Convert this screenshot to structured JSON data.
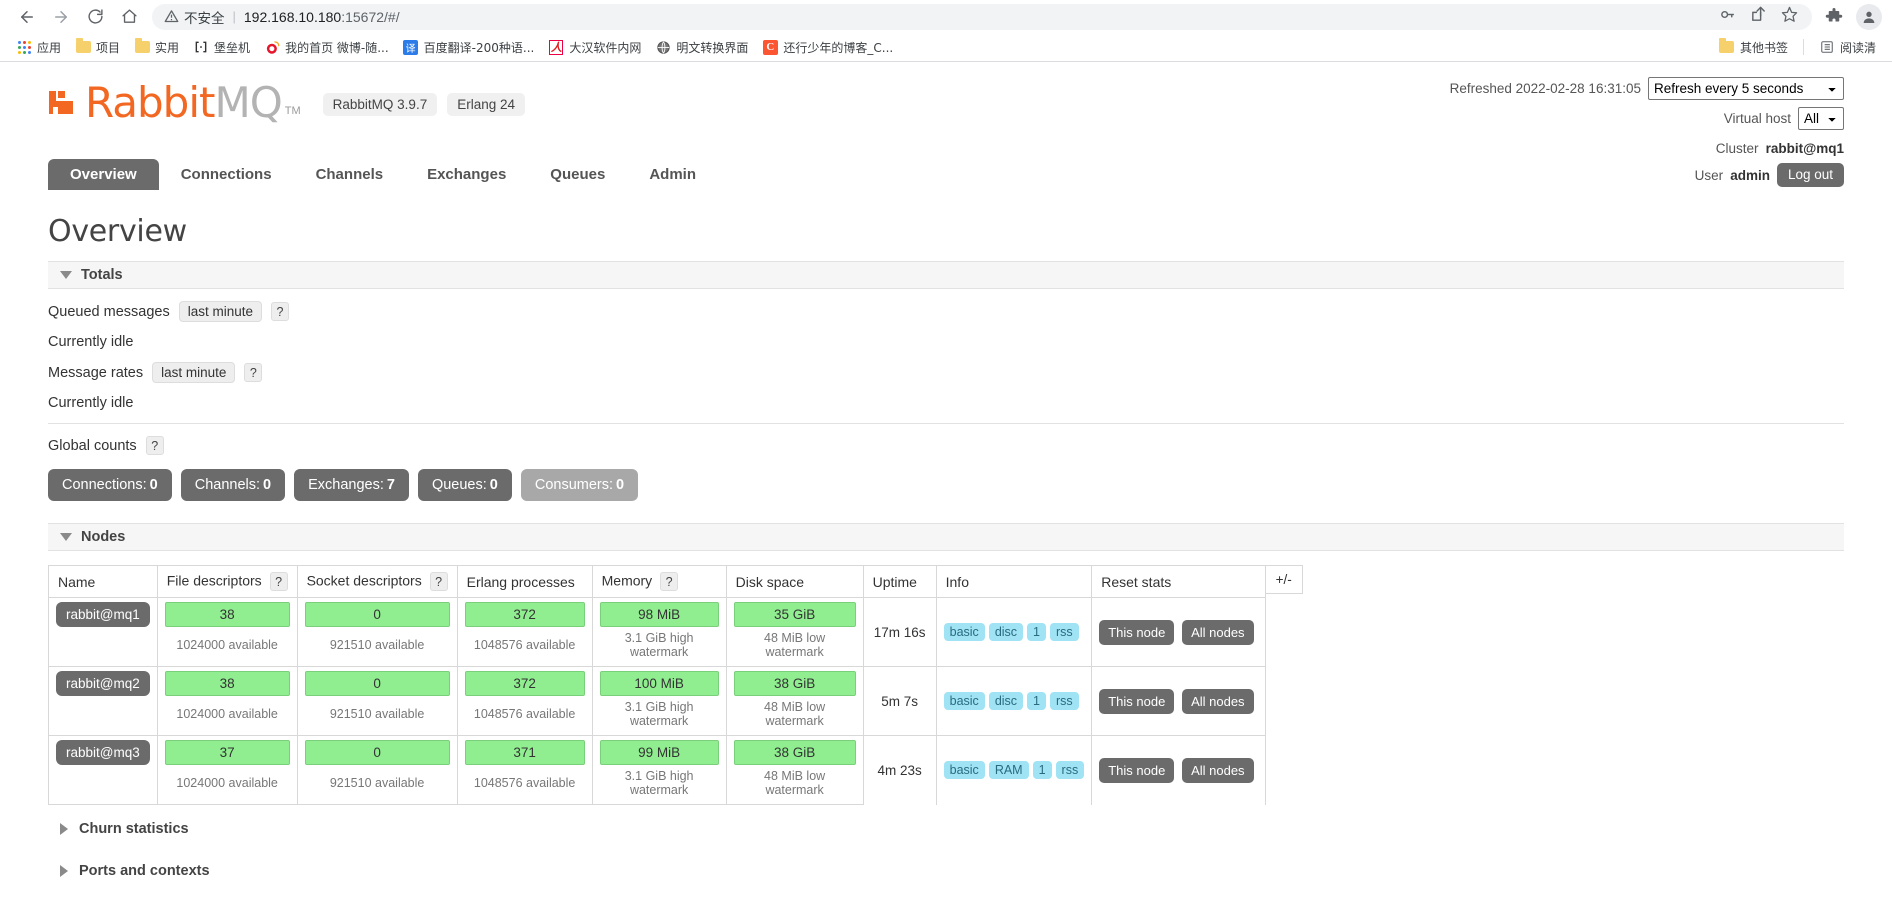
{
  "browser": {
    "nav": {
      "back_icon": "arrow-left-icon",
      "forward_icon": "arrow-right-icon",
      "reload_icon": "reload-icon",
      "home_icon": "home-icon"
    },
    "omnibox": {
      "security_label": "不安全",
      "separator": "|",
      "url_host": "192.168.10.180",
      "url_rest": ":15672/#/",
      "url_full": "192.168.10.180:15672/#/"
    },
    "toolbar_icons": [
      "key-icon",
      "share-icon",
      "star-icon",
      "extensions-icon",
      "profile-avatar-icon"
    ],
    "bookmarks": [
      {
        "label": "应用",
        "icon": "apps-grid-icon"
      },
      {
        "label": "项目",
        "icon": "folder-icon"
      },
      {
        "label": "实用",
        "icon": "folder-icon"
      },
      {
        "label": "堡垒机",
        "icon": "bracket-icon"
      },
      {
        "label": "我的首页 微博-随...",
        "icon": "weibo-icon"
      },
      {
        "label": "百度翻译-200种语...",
        "icon": "translate-icon"
      },
      {
        "label": "大汉软件内网",
        "icon": "pdf-icon"
      },
      {
        "label": "明文转换界面",
        "icon": "globe-icon"
      },
      {
        "label": "还行少年的博客_C...",
        "icon": "csdn-icon"
      }
    ],
    "bookmarks_right": [
      {
        "label": "其他书签",
        "icon": "folder-icon"
      },
      {
        "label": "阅读清",
        "icon": "reading-list-icon"
      }
    ]
  },
  "header": {
    "logo_rabbit": "Rabbit",
    "logo_mq": "MQ",
    "logo_tm": "TM",
    "badges": [
      "RabbitMQ 3.9.7",
      "Erlang 24"
    ],
    "refreshed_label": "Refreshed 2022-02-28 16:31:05",
    "refresh_select": "Refresh every 5 seconds",
    "vhost_label": "Virtual host",
    "vhost_select": "All",
    "cluster_label": "Cluster",
    "cluster_value": "rabbit@mq1",
    "user_label": "User",
    "user_value": "admin",
    "logout_label": "Log out"
  },
  "tabs": [
    {
      "label": "Overview",
      "active": true
    },
    {
      "label": "Connections",
      "active": false
    },
    {
      "label": "Channels",
      "active": false
    },
    {
      "label": "Exchanges",
      "active": false
    },
    {
      "label": "Queues",
      "active": false
    },
    {
      "label": "Admin",
      "active": false
    }
  ],
  "page": {
    "title": "Overview"
  },
  "totals": {
    "section_label": "Totals",
    "queued_label": "Queued messages",
    "queued_period": "last minute",
    "queued_idle": "Currently idle",
    "rates_label": "Message rates",
    "rates_period": "last minute",
    "rates_idle": "Currently idle",
    "global_counts_label": "Global counts",
    "help_glyph": "?",
    "counts": [
      {
        "label": "Connections:",
        "value": "0",
        "muted": false
      },
      {
        "label": "Channels:",
        "value": "0",
        "muted": false
      },
      {
        "label": "Exchanges:",
        "value": "7",
        "muted": false
      },
      {
        "label": "Queues:",
        "value": "0",
        "muted": false
      },
      {
        "label": "Consumers:",
        "value": "0",
        "muted": true
      }
    ]
  },
  "nodes": {
    "section_label": "Nodes",
    "plusminus_label": "+/-",
    "columns": [
      "Name",
      "File descriptors",
      "Socket descriptors",
      "Erlang processes",
      "Memory",
      "Disk space",
      "Uptime",
      "Info",
      "Reset stats"
    ],
    "columns_help": {
      "file_descriptors": "?",
      "socket_descriptors": "?",
      "memory": "?"
    },
    "reset_buttons": {
      "this_node": "This node",
      "all_nodes": "All nodes"
    },
    "rows": [
      {
        "name": "rabbit@mq1",
        "file_descriptors": "38",
        "file_descriptors_sub": "1024000 available",
        "socket_descriptors": "0",
        "socket_descriptors_sub": "921510 available",
        "erlang_processes": "372",
        "erlang_processes_sub": "1048576 available",
        "memory": "98 MiB",
        "memory_sub": "3.1 GiB high watermark",
        "disk_space": "35 GiB",
        "disk_space_sub": "48 MiB low watermark",
        "uptime": "17m 16s",
        "info": [
          "basic",
          "disc",
          "1",
          "rss"
        ]
      },
      {
        "name": "rabbit@mq2",
        "file_descriptors": "38",
        "file_descriptors_sub": "1024000 available",
        "socket_descriptors": "0",
        "socket_descriptors_sub": "921510 available",
        "erlang_processes": "372",
        "erlang_processes_sub": "1048576 available",
        "memory": "100 MiB",
        "memory_sub": "3.1 GiB high watermark",
        "disk_space": "38 GiB",
        "disk_space_sub": "48 MiB low watermark",
        "uptime": "5m 7s",
        "info": [
          "basic",
          "disc",
          "1",
          "rss"
        ]
      },
      {
        "name": "rabbit@mq3",
        "file_descriptors": "37",
        "file_descriptors_sub": "1024000 available",
        "socket_descriptors": "0",
        "socket_descriptors_sub": "921510 available",
        "erlang_processes": "371",
        "erlang_processes_sub": "1048576 available",
        "memory": "99 MiB",
        "memory_sub": "3.1 GiB high watermark",
        "disk_space": "38 GiB",
        "disk_space_sub": "48 MiB low watermark",
        "uptime": "4m 23s",
        "info": [
          "basic",
          "RAM",
          "1",
          "rss"
        ]
      }
    ]
  },
  "collapsed_sections": [
    {
      "label": "Churn statistics"
    },
    {
      "label": "Ports and contexts"
    }
  ]
}
